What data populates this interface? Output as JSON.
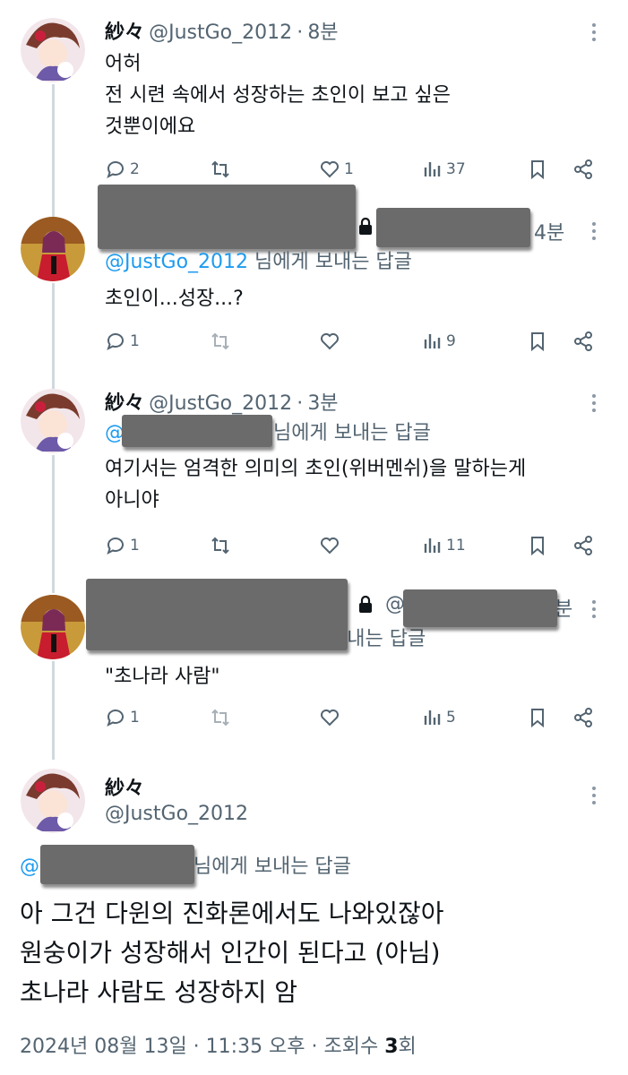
{
  "tweets": [
    {
      "name": "紗々",
      "handle": "@JustGo_2012",
      "sep": "·",
      "time": "8분",
      "lines": [
        "어허",
        "전  시련 속에서 성장하는 초인이 보고 싶은",
        "것뿐이에요"
      ],
      "reply_count": "2",
      "view_count": "37"
    },
    {
      "time_partial": "4분",
      "reply_to_mention": "@JustGo_2012",
      "reply_to_suffix": " 님에게 보내는 답글",
      "lines": [
        "초인이...성장...?"
      ],
      "reply_count": "1",
      "view_count": "9"
    },
    {
      "name": "紗々",
      "handle": "@JustGo_2012",
      "sep": "·",
      "time": "3분",
      "reply_to_mention": "@",
      "reply_to_suffix": "님에게 보내는 답글",
      "lines": [
        "여기서는 엄격한 의미의 초인(위버멘쉬)을 말하는게",
        "아니야"
      ],
      "reply_count": "1",
      "view_count": "11"
    },
    {
      "handle_partial": "@",
      "time_partial": "분",
      "reply_to_partial": "보내는 답글",
      "lines": [
        "\"초나라 사람\""
      ],
      "reply_count": "1",
      "view_count": "5"
    }
  ],
  "main_tweet": {
    "name": "紗々",
    "handle": "@JustGo_2012",
    "reply_to_mention": "@",
    "reply_to_suffix": "님에게 보내는 답글",
    "lines": [
      "아 그건 다윈의 진화론에서도 나와있잖아",
      "원숭이가 성장해서 인간이 된다고 (아님)",
      "초나라 사람도 성장하지 암"
    ],
    "meta_date": "2024년 08월 13일 · 11:35 오후 · 조회수 ",
    "meta_views": "3",
    "meta_unit": "회"
  },
  "colors": {
    "accent": "#1d9bf0",
    "text": "#0f1419",
    "muted": "#536471",
    "redaction": "#6b6b6b"
  }
}
